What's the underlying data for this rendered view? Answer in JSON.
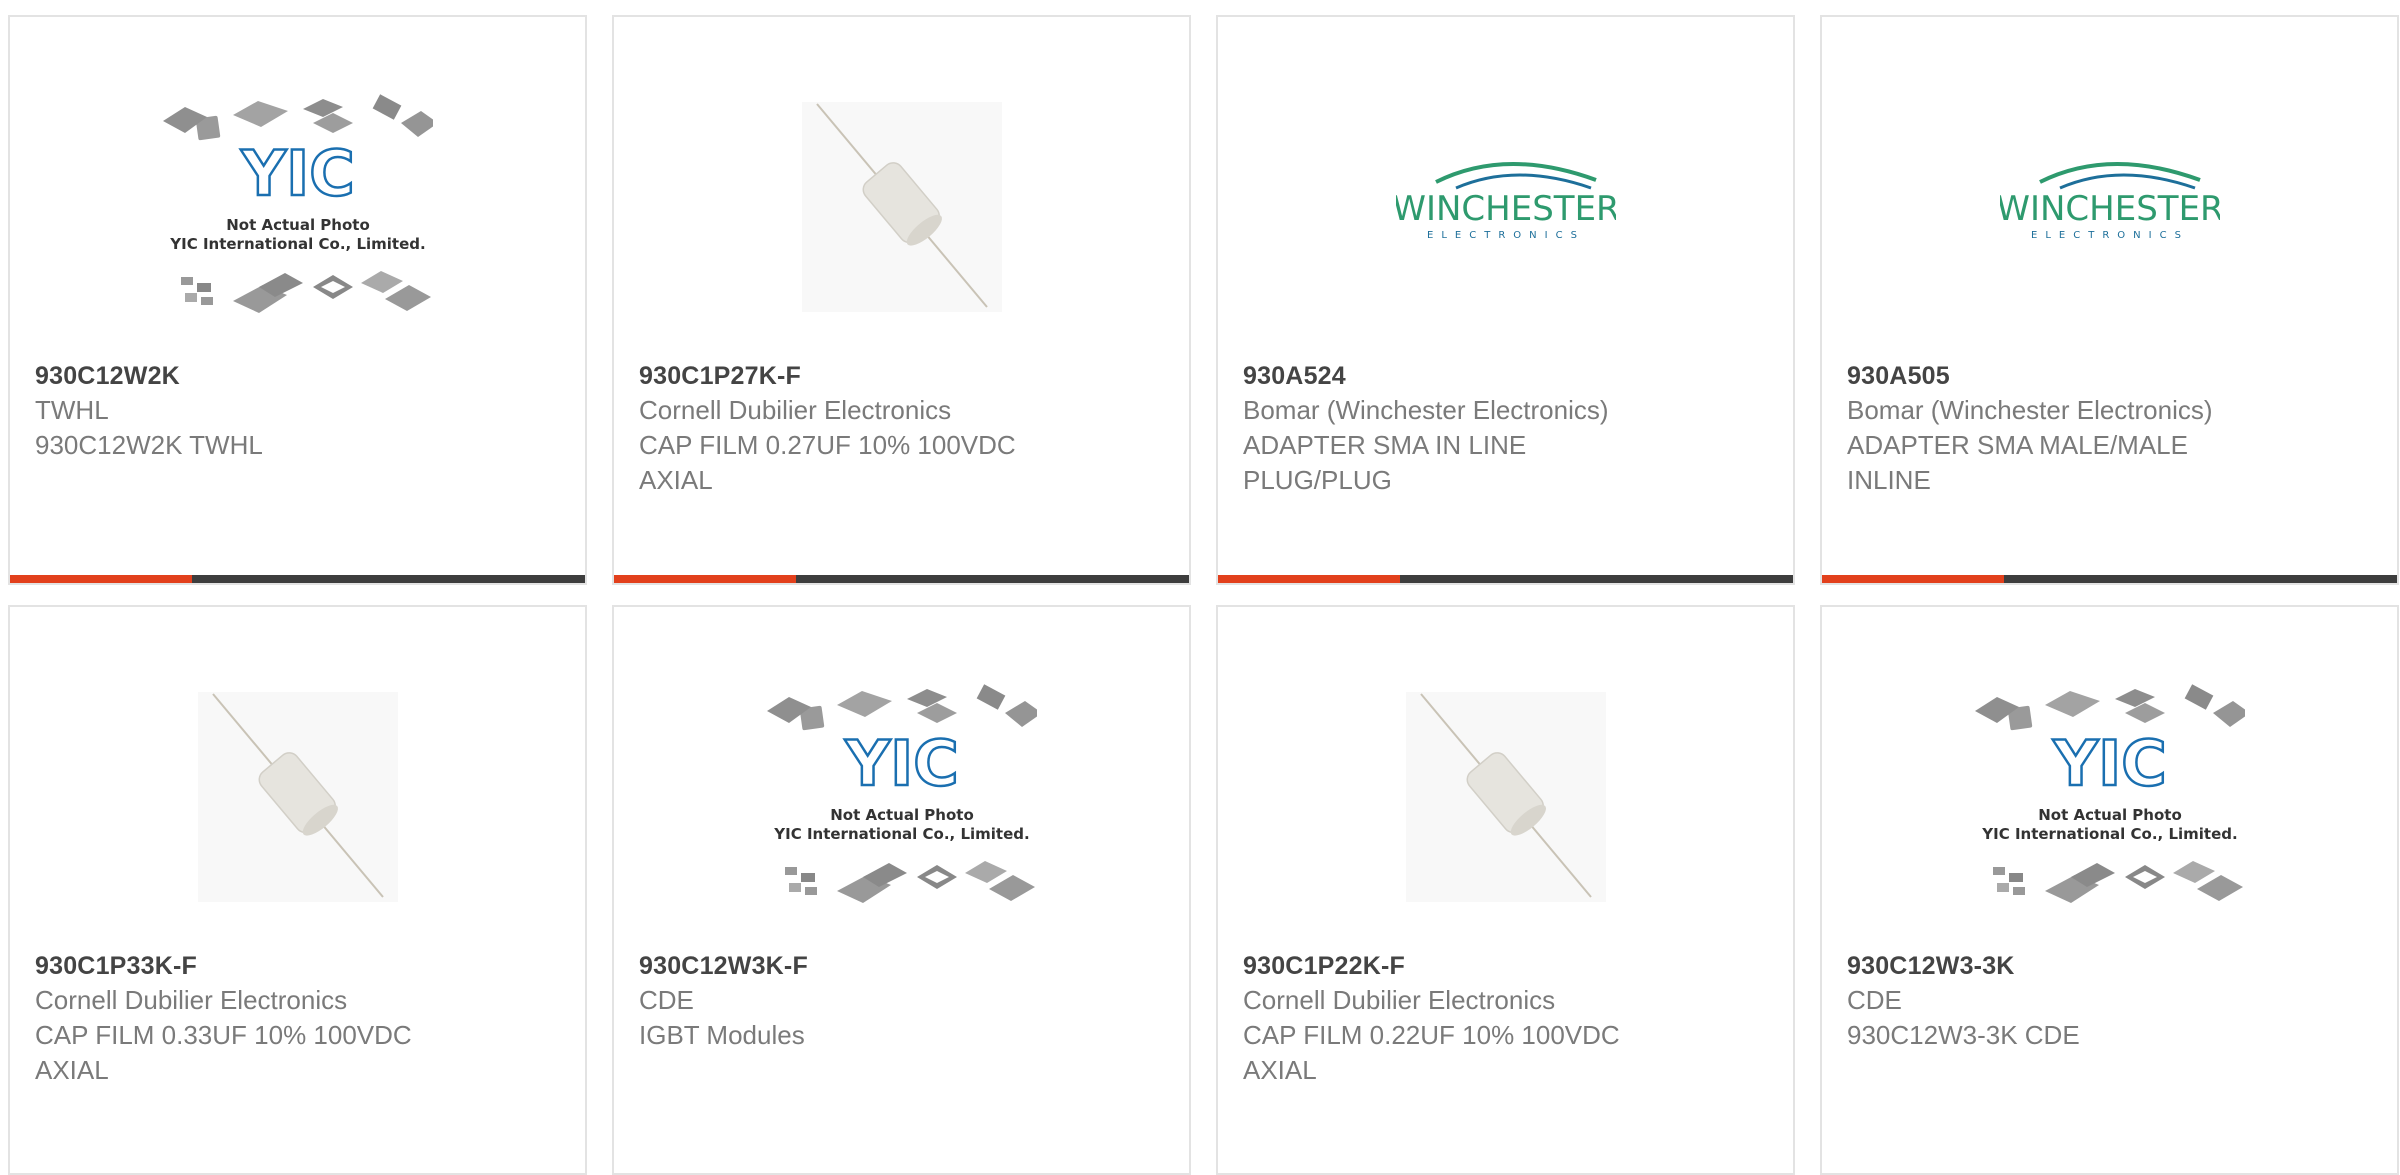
{
  "products": [
    {
      "part_number": "930C12W2K",
      "manufacturer": "TWHL",
      "description": "930C12W2K TWHL",
      "image": "yic-placeholder"
    },
    {
      "part_number": "930C1P27K-F",
      "manufacturer": "Cornell Dubilier Electronics",
      "description": "CAP FILM 0.27UF 10% 100VDC AXIAL",
      "image": "axial-capacitor"
    },
    {
      "part_number": "930A524",
      "manufacturer": "Bomar (Winchester Electronics)",
      "description": "ADAPTER SMA IN LINE PLUG/PLUG",
      "image": "winchester-logo"
    },
    {
      "part_number": "930A505",
      "manufacturer": "Bomar (Winchester Electronics)",
      "description": "ADAPTER SMA MALE/MALE INLINE",
      "image": "winchester-logo"
    },
    {
      "part_number": "930C1P33K-F",
      "manufacturer": "Cornell Dubilier Electronics",
      "description": "CAP FILM 0.33UF 10% 100VDC AXIAL",
      "image": "axial-capacitor"
    },
    {
      "part_number": "930C12W3K-F",
      "manufacturer": "CDE",
      "description": "IGBT Modules",
      "image": "yic-placeholder"
    },
    {
      "part_number": "930C1P22K-F",
      "manufacturer": "Cornell Dubilier Electronics",
      "description": "CAP FILM 0.22UF 10% 100VDC AXIAL",
      "image": "axial-capacitor"
    },
    {
      "part_number": "930C12W3-3K",
      "manufacturer": "CDE",
      "description": "930C12W3-3K CDE",
      "image": "yic-placeholder"
    }
  ],
  "placeholder": {
    "line1": "Not Actual Photo",
    "line2": "YIC International Co., Limited.",
    "logo_text": "YIC"
  },
  "winchester": {
    "name": "WINCHESTER",
    "tagline": "ELECTRONICS"
  },
  "colors": {
    "accent": "#e2401c",
    "bar": "#3d3d3d",
    "part_number": "#444444",
    "secondary_text": "#7a7a7a",
    "winchester_green": "#2e9a6e",
    "winchester_blue": "#1d6f9a",
    "yic_blue": "#1a6fb0"
  }
}
